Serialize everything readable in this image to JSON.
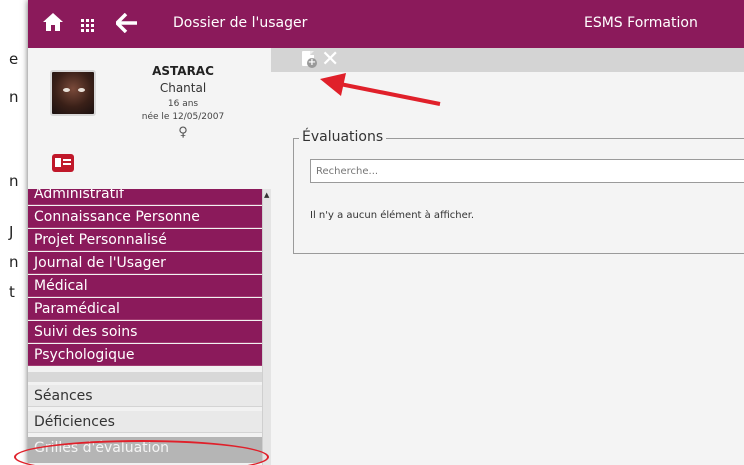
{
  "left_strip": {
    "chars": [
      "e",
      "n",
      "n",
      "J",
      "n",
      "t"
    ]
  },
  "topbar": {
    "home_icon": "home-icon",
    "grid_icon": "grid-icon",
    "back_icon": "back-arrow-icon",
    "title": "Dossier de l'usager",
    "org": "ESMS Formation",
    "color": "#8b1a5b"
  },
  "profile": {
    "last_name": "ASTARAC",
    "first_name": "Chantal",
    "age": "16 ans",
    "birth": "née le 12/05/2007",
    "sex_symbol": "♀",
    "card_icon": "id-card-icon"
  },
  "menu": {
    "primary": [
      "Administratif",
      "Connaissance Personne",
      "Projet Personnalisé",
      "Journal de l'Usager",
      "Médical",
      "Paramédical",
      "Suivi des soins",
      "Psychologique"
    ],
    "secondary": [
      "Séances",
      "Déficiences",
      "Grilles d'évaluation"
    ]
  },
  "toolbar": {
    "add_icon": "add-document-icon",
    "delete_icon": "close-icon"
  },
  "evaluations": {
    "legend": "Évaluations",
    "search_placeholder": "Recherche...",
    "empty_message": "Il n'y a aucun élément à afficher."
  }
}
